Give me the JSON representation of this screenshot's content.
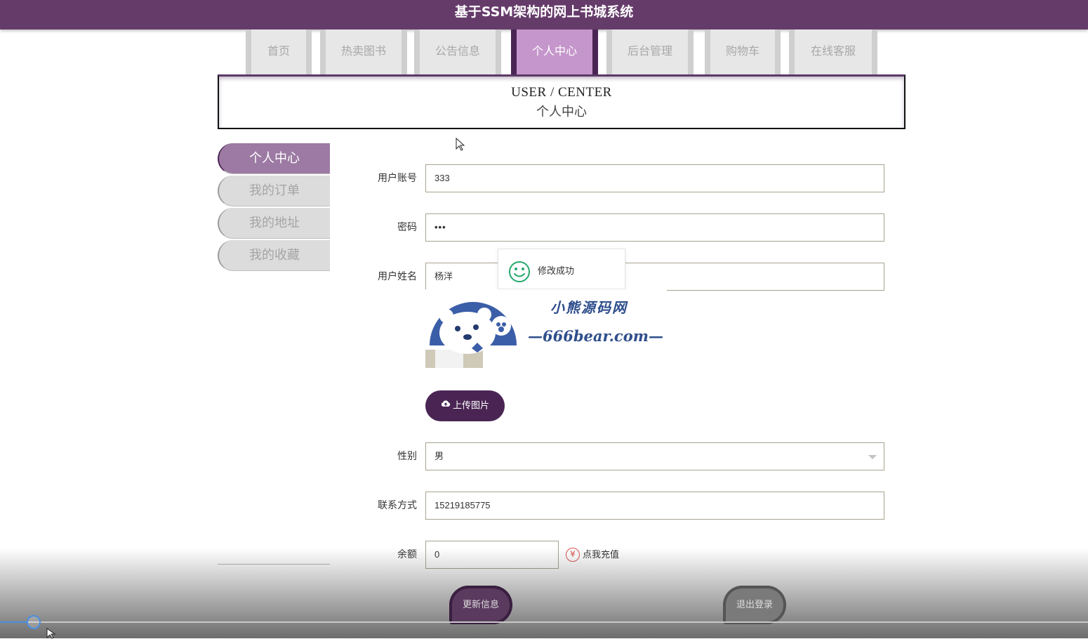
{
  "site_title": "基于SSM架构的网上书城系统",
  "nav": {
    "items": [
      {
        "label": "首页"
      },
      {
        "label": "热卖图书"
      },
      {
        "label": "公告信息"
      },
      {
        "label": "个人中心",
        "active": true
      },
      {
        "label": "后台管理"
      },
      {
        "label": "购物车"
      },
      {
        "label": "在线客服"
      }
    ]
  },
  "banner": {
    "title_en": "USER / CENTER",
    "title_cn": "个人中心"
  },
  "side_menu": {
    "items": [
      {
        "label": "个人中心",
        "active": true
      },
      {
        "label": "我的订单"
      },
      {
        "label": "我的地址"
      },
      {
        "label": "我的收藏"
      }
    ]
  },
  "form": {
    "account": {
      "label": "用户账号",
      "value": "333"
    },
    "password": {
      "label": "密码",
      "value": "•••"
    },
    "name": {
      "label": "用户姓名",
      "value": "杨洋"
    },
    "upload_label": "上传图片",
    "gender": {
      "label": "性别",
      "value": "男"
    },
    "phone": {
      "label": "联系方式",
      "value": "15219185775"
    },
    "balance": {
      "label": "余额",
      "value": "0"
    },
    "recharge_label": "点我充值",
    "recharge_icon": "¥"
  },
  "toast": {
    "message": "修改成功"
  },
  "watermark": {
    "line1": "小熊源码网",
    "line2": "—666bear.com—"
  },
  "actions": {
    "update_label": "更新信息",
    "logout_label": "退出登录"
  },
  "colors": {
    "brand": "#653b6a",
    "accent": "#c596cb",
    "dark": "#4a2554"
  }
}
